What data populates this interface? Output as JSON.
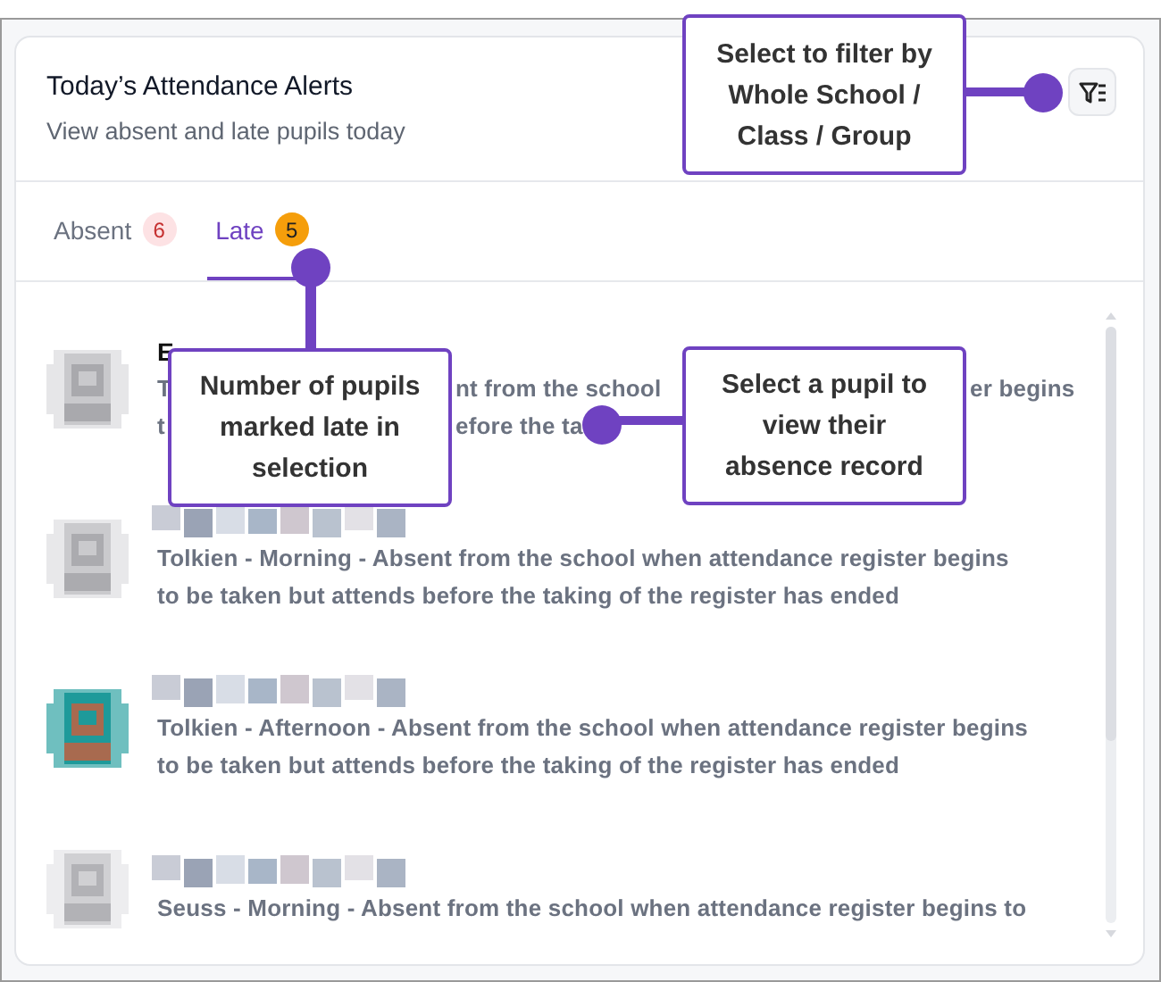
{
  "header": {
    "title": "Today’s Attendance Alerts",
    "subtitle": "View absent and late pupils today"
  },
  "tabs": [
    {
      "label": "Absent",
      "count": "6",
      "selected": false,
      "color": "#fde2e4"
    },
    {
      "label": "Late",
      "count": "5",
      "selected": true,
      "color": "#f59e0b"
    }
  ],
  "pupils": [
    {
      "name": "E",
      "lines": [
        [
          "T",
          "nt from the school",
          "er begins"
        ],
        [
          "t",
          "efore the ta"
        ]
      ]
    },
    {
      "lines": [
        [
          "Tolkien - Morning - Absent from the school when attendance register begins"
        ],
        [
          "to be taken but attends before the taking of the register has ended"
        ]
      ]
    },
    {
      "lines": [
        [
          "Tolkien - Afternoon - Absent from the school when attendance register begins"
        ],
        [
          "to be taken but attends before the taking of the register has ended"
        ]
      ]
    },
    {
      "lines": [
        [
          "Seuss - Morning - Absent from the school when attendance register begins to"
        ]
      ]
    }
  ],
  "callouts": [
    {
      "kind": "filter",
      "text": "Select to filter by Whole School / Class / Group"
    },
    {
      "kind": "count",
      "text": "Number of pupils marked late in selection"
    },
    {
      "kind": "pupil",
      "text": "Select a pupil to view their absence record"
    }
  ]
}
